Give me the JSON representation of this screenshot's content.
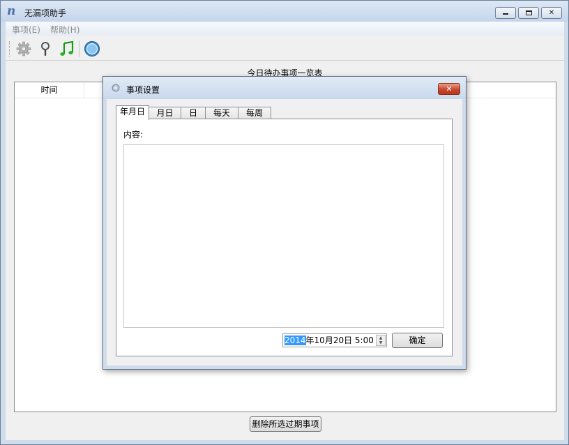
{
  "window": {
    "title": "无漏项助手",
    "icon": "app-logo-n"
  },
  "menu": [
    {
      "label": "事项(E)"
    },
    {
      "label": "帮助(H)"
    }
  ],
  "toolbar": {
    "icons": [
      "gear-icon",
      "search-icon",
      "music-note-icon",
      "about-icon"
    ]
  },
  "list": {
    "title": "今日待办事项一览表",
    "columns": [
      "时间"
    ],
    "rows": []
  },
  "delete_button": "删除所选过期事项",
  "dialog": {
    "title": "事项设置",
    "close_label": "✕",
    "tabs": [
      "年月日",
      "月日",
      "日",
      "每天",
      "每周"
    ],
    "active_tab": "年月日",
    "content_label": "内容:",
    "content_value": "",
    "datetime": {
      "selected_part": "2014",
      "rest": "年10月20日  5:00"
    },
    "ok_label": "确定"
  },
  "colors": {
    "titlebar": "#c4d5eb",
    "close_button": "#c8462c",
    "selection": "#3399ff"
  }
}
